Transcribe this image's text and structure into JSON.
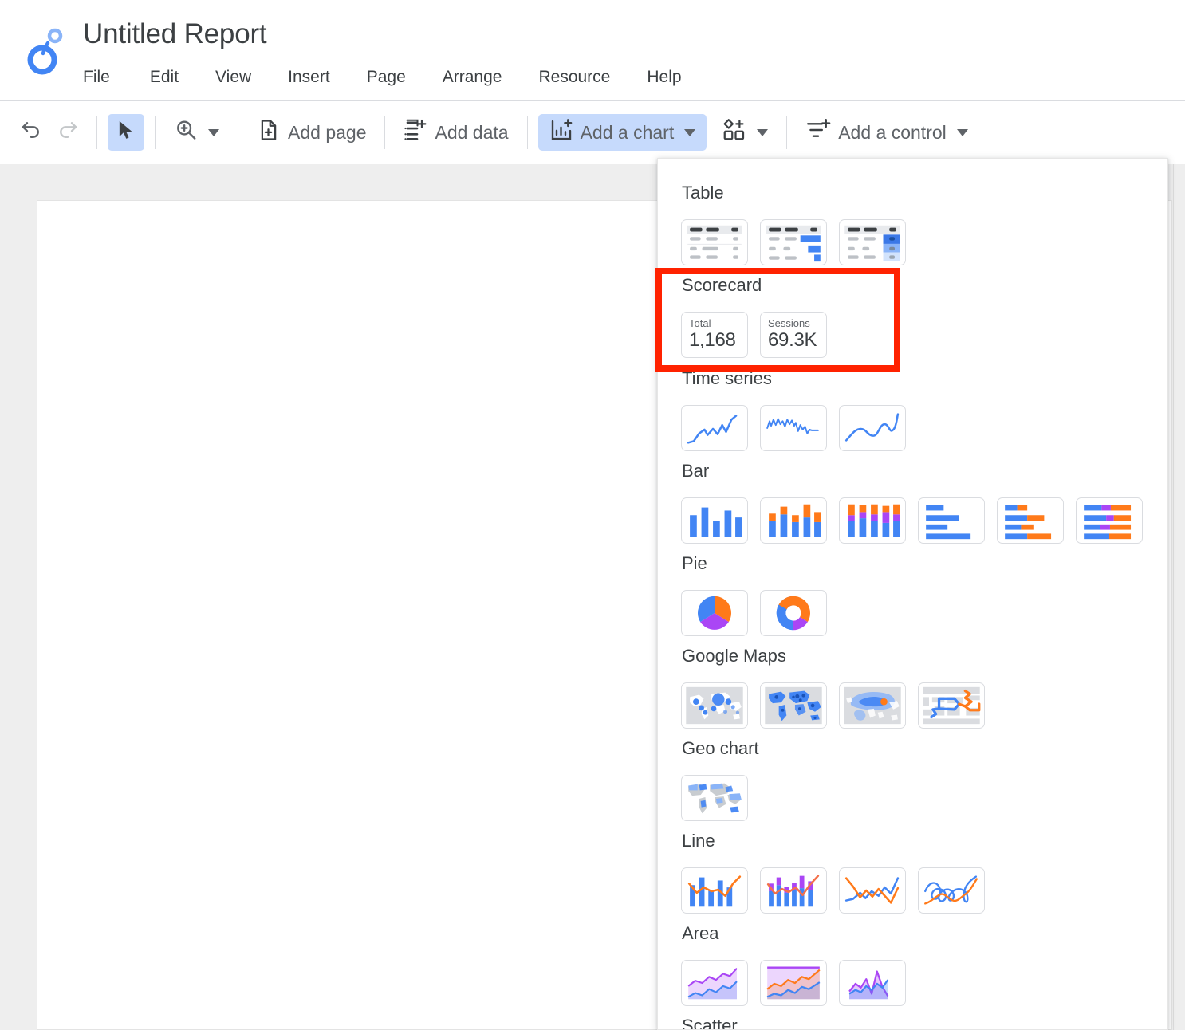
{
  "app": {
    "logo_icon": "looker-studio-logo",
    "document_title": "Untitled Report",
    "menu": [
      {
        "label": "File"
      },
      {
        "label": "Edit"
      },
      {
        "label": "View"
      },
      {
        "label": "Insert"
      },
      {
        "label": "Page"
      },
      {
        "label": "Arrange"
      },
      {
        "label": "Resource"
      },
      {
        "label": "Help"
      }
    ]
  },
  "toolbar": {
    "undo": {
      "icon": "undo-icon",
      "label": "Undo"
    },
    "redo": {
      "icon": "redo-icon",
      "label": "Redo"
    },
    "select": {
      "icon": "cursor-arrow-icon",
      "label": "Select"
    },
    "zoom": {
      "icon": "zoom-in-icon",
      "label": "Zoom"
    },
    "add_page": {
      "icon": "add-page-icon",
      "label": "Add page"
    },
    "add_data": {
      "icon": "add-data-icon",
      "label": "Add data"
    },
    "add_chart": {
      "icon": "add-chart-icon",
      "label": "Add a chart"
    },
    "add_shape": {
      "icon": "add-shape-icon",
      "label": "Add a shape"
    },
    "add_control": {
      "icon": "add-control-icon",
      "label": "Add a control"
    }
  },
  "dropdown": {
    "name": "add-a-chart-menu",
    "sections": [
      {
        "title": "Table",
        "items": [
          {
            "name": "table-plain"
          },
          {
            "name": "table-with-bars"
          },
          {
            "name": "table-with-heatmap"
          }
        ]
      },
      {
        "title": "Scorecard",
        "items": [
          {
            "name": "scorecard",
            "label": "Total",
            "value": "1,168"
          },
          {
            "name": "scorecard-compact",
            "label": "Sessions",
            "value": "69.3K"
          }
        ]
      },
      {
        "title": "Time series",
        "items": [
          {
            "name": "time-series-line"
          },
          {
            "name": "time-series-dense"
          },
          {
            "name": "time-series-smooth"
          }
        ]
      },
      {
        "title": "Bar",
        "items": [
          {
            "name": "column-chart"
          },
          {
            "name": "stacked-column-chart"
          },
          {
            "name": "100-stacked-column-chart"
          },
          {
            "name": "bar-chart"
          },
          {
            "name": "stacked-bar-chart"
          },
          {
            "name": "100-stacked-bar-chart"
          }
        ]
      },
      {
        "title": "Pie",
        "items": [
          {
            "name": "pie-chart"
          },
          {
            "name": "donut-chart"
          }
        ]
      },
      {
        "title": "Google Maps",
        "items": [
          {
            "name": "bubble-map"
          },
          {
            "name": "filled-map"
          },
          {
            "name": "heatmap"
          },
          {
            "name": "route-map"
          }
        ]
      },
      {
        "title": "Geo chart",
        "items": [
          {
            "name": "geo-chart"
          }
        ]
      },
      {
        "title": "Line",
        "items": [
          {
            "name": "combo-chart"
          },
          {
            "name": "stacked-combo-chart"
          },
          {
            "name": "line-chart"
          },
          {
            "name": "smoothed-line-chart"
          }
        ]
      },
      {
        "title": "Area",
        "items": [
          {
            "name": "area-chart"
          },
          {
            "name": "stacked-area-chart"
          },
          {
            "name": "overlapping-area-chart"
          }
        ]
      },
      {
        "title": "Scatter",
        "items": []
      }
    ]
  },
  "colors": {
    "accent_blue": "#4285f4",
    "orange": "#ff7a1a",
    "purple": "#aa46f5",
    "highlight_red": "#ff2200",
    "toolbar_active_bg": "#c6dafc",
    "text_primary": "#3c4043",
    "text_secondary": "#5f6368"
  }
}
